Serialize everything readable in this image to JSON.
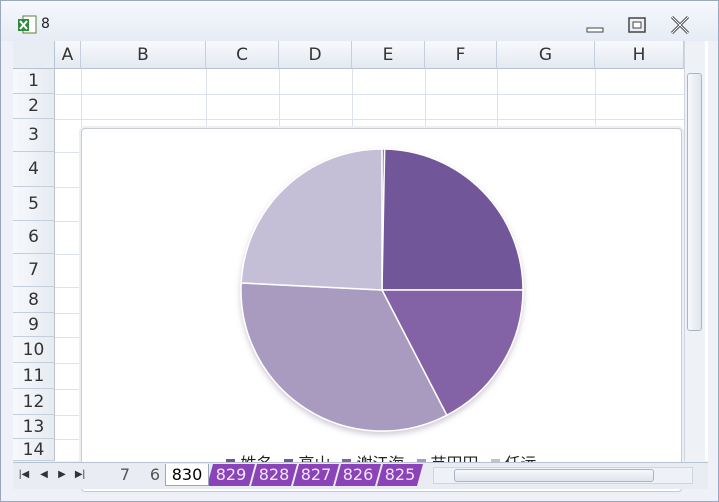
{
  "window": {
    "title": "8"
  },
  "grid": {
    "columns": [
      "A",
      "B",
      "C",
      "D",
      "E",
      "F",
      "G",
      "H"
    ],
    "rows": [
      "1",
      "2",
      "3",
      "4",
      "5",
      "6",
      "7",
      "8",
      "9",
      "10",
      "11",
      "12",
      "13",
      "14"
    ]
  },
  "sheet_tabs": [
    "7",
    "6",
    "830",
    "829",
    "828",
    "827",
    "826",
    "825"
  ],
  "active_tab": "830",
  "colors": {
    "accent_tab": "#8a44b8"
  },
  "chart_data": {
    "type": "pie",
    "start": "12 o'clock, clockwise",
    "slices": [
      {
        "name": "姓名",
        "value": 0.3,
        "color": "#70588f"
      },
      {
        "name": "高山",
        "value": 24.7,
        "color": "#71579a"
      },
      {
        "name": "谢江海",
        "value": 17.4,
        "color": "#8462a6"
      },
      {
        "name": "苗田田",
        "value": 33.4,
        "color": "#a99ac0"
      },
      {
        "name": "任远",
        "value": 24.2,
        "color": "#c5bed7"
      }
    ],
    "legend": [
      "姓名",
      "高山",
      "谢江海",
      "苗田田",
      "任远"
    ],
    "legend_position": "bottom"
  }
}
